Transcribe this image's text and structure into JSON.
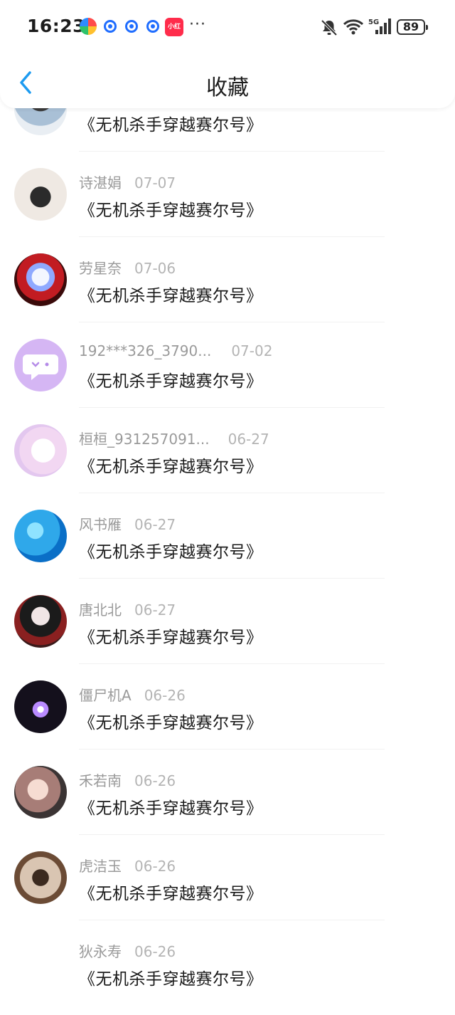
{
  "status_bar": {
    "time": "16:23",
    "red_app_label": "小红书",
    "more": "···",
    "battery": "89"
  },
  "header": {
    "title": "收藏"
  },
  "items": [
    {
      "name": "",
      "date": "",
      "content": "《无机杀手穿越赛尔号》"
    },
    {
      "name": "诗湛娟",
      "date": "07-07",
      "content": "《无机杀手穿越赛尔号》"
    },
    {
      "name": "劳星奈",
      "date": "07-06",
      "content": "《无机杀手穿越赛尔号》"
    },
    {
      "name": "192***326_3790...",
      "date": "07-02",
      "content": "《无机杀手穿越赛尔号》"
    },
    {
      "name": "桓桓_931257091...",
      "date": "06-27",
      "content": "《无机杀手穿越赛尔号》"
    },
    {
      "name": "风书雁",
      "date": "06-27",
      "content": "《无机杀手穿越赛尔号》"
    },
    {
      "name": "唐北北",
      "date": "06-27",
      "content": "《无机杀手穿越赛尔号》"
    },
    {
      "name": "僵尸机A",
      "date": "06-26",
      "content": "《无机杀手穿越赛尔号》"
    },
    {
      "name": "禾若南",
      "date": "06-26",
      "content": "《无机杀手穿越赛尔号》"
    },
    {
      "name": "虎洁玉",
      "date": "06-26",
      "content": "《无机杀手穿越赛尔号》"
    },
    {
      "name": "狄永寿",
      "date": "06-26",
      "content": "《无机杀手穿越赛尔号》"
    }
  ],
  "colors": {
    "accent": "#1d9bf0",
    "text_primary": "#1b1b1b",
    "text_meta": "#9a9a9a"
  }
}
